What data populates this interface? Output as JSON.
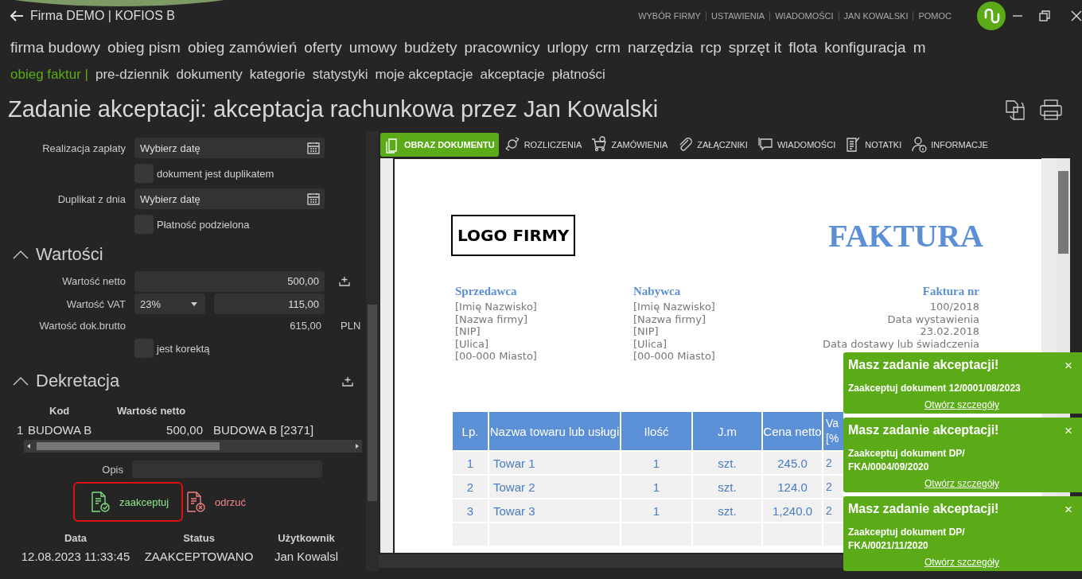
{
  "header": {
    "title": "Firma DEMO | KOFIOS B",
    "links": [
      "WYBÓR FIRMY",
      "USTAWIENIA",
      "WIADOMOŚCI",
      "JAN KOWALSKI",
      "POMOC"
    ]
  },
  "modules": [
    "firma budowy",
    "obieg pism",
    "obieg zamówień",
    "oferty",
    "umowy",
    "budżety",
    "pracownicy",
    "urlopy",
    "crm",
    "narzędzia",
    "rcp",
    "sprzęt it",
    "flota",
    "konfiguracja",
    "m"
  ],
  "submenu": {
    "section": "obieg faktur |",
    "items": [
      "pre-dziennik",
      "dokumenty",
      "kategorie",
      "statystyki",
      "moje akceptacje",
      "akceptacje",
      "płatności"
    ]
  },
  "page_title": "Zadanie akceptacji: akceptacja rachunkowa przez Jan Kowalski",
  "form": [
    {
      "kind": "date",
      "label": "Realizacja zapłaty",
      "placeholder": "Wybierz datę"
    },
    {
      "kind": "checkbox",
      "label": "dokument jest duplikatem",
      "checked": false
    },
    {
      "kind": "date",
      "label": "Duplikat z dnia",
      "placeholder": "Wybierz datę"
    },
    {
      "kind": "checkbox",
      "label": "Płatność podzielona",
      "checked": false
    }
  ],
  "values": {
    "title": "Wartości",
    "expanded": true,
    "rows": [
      {
        "kind": "amount",
        "label": "Wartość netto",
        "value": "500,00"
      },
      {
        "kind": "vat",
        "label": "Wartość VAT",
        "rate": "23%",
        "value": "115,00"
      },
      {
        "kind": "total",
        "label": "Wartość dok.brutto",
        "value": "615,00",
        "currency": "PLN"
      },
      {
        "kind": "checkbox",
        "label": "jest korektą",
        "checked": false
      }
    ]
  },
  "decree": {
    "title": "Dekretacja",
    "expanded": true,
    "columns": [
      "Kod",
      "Wartość netto"
    ],
    "rows": [
      {
        "number": "1",
        "cells": [
          "BUDOWA B",
          "500,00",
          "BUDOWA B [2371]"
        ]
      }
    ],
    "description": {
      "label": "Opis"
    }
  },
  "actions": [
    {
      "kind": "accept",
      "label": "zaakceptuj",
      "focused": true
    },
    {
      "kind": "reject",
      "label": "odrzuć",
      "focused": false
    }
  ],
  "history": {
    "columns": [
      "Data",
      "Status",
      "Użytkownik"
    ],
    "rows": [
      [
        "12.08.2023 11:33:45",
        "ZAAKCEPTOWANO",
        "Jan Kowalsl"
      ]
    ]
  },
  "tabs": [
    {
      "label": "OBRAZ DOKUMENTU",
      "selected": true
    },
    {
      "label": "ROZLICZENIA",
      "selected": false
    },
    {
      "label": "ZAMÓWIENIA",
      "selected": false
    },
    {
      "label": "ZAŁĄCZNIKI",
      "selected": false
    },
    {
      "label": "WIADOMOŚCI",
      "selected": false
    },
    {
      "label": "NOTATKI",
      "selected": false
    },
    {
      "label": "INFORMACJE",
      "selected": false
    }
  ],
  "document": {
    "logo": "LOGO FIRMY",
    "title": "FAKTURA",
    "parties": [
      {
        "heading": "Sprzedawca",
        "lines": [
          "[Imię Nazwisko]",
          "[Nazwa firmy]",
          "[NIP]",
          "[Ulica]",
          "[00-000 Miasto]"
        ]
      },
      {
        "heading": "Nabywca",
        "lines": [
          "[Imię Nazwisko]",
          "[Nazwa firmy]",
          "[NIP]",
          "[Ulica]",
          "[00-000 Miasto]"
        ]
      }
    ],
    "invoice": {
      "heading": "Faktura nr",
      "lines": [
        "100/2018",
        "Data wystawienia",
        "23.02.2018",
        "Data dostawy lub świadczenia"
      ]
    },
    "table": {
      "columns": [
        "Lp.",
        "Nazwa towaru lub usługi",
        "Ilość",
        "J.m",
        "Cena netto",
        "Va [%"
      ],
      "rows": [
        [
          "1",
          "Towar 1",
          "1",
          "szt.",
          "245.0",
          "2"
        ],
        [
          "2",
          "Towar 2",
          "1",
          "szt.",
          "124.0",
          "2"
        ],
        [
          "3",
          "Towar 3",
          "1",
          "szt.",
          "1,240.0",
          "2"
        ]
      ]
    }
  },
  "notifications": [
    {
      "title": "Masz zadanie akceptacji!",
      "close": "×",
      "message": "Zaakceptuj dokument 12/0001/08/2023",
      "link": "Otwórz szczegóły"
    },
    {
      "title": "Masz zadanie akceptacji!",
      "close": "×",
      "message": "Zaakceptuj dokument DP/ FKA/0004/09/2020",
      "link": "Otwórz szczegóły"
    },
    {
      "title": "Masz zadanie akceptacji!",
      "close": "×",
      "message": "Zaakceptuj dokument DP/ FKA/0021/11/2020",
      "link": "Otwórz szczegóły"
    }
  ]
}
